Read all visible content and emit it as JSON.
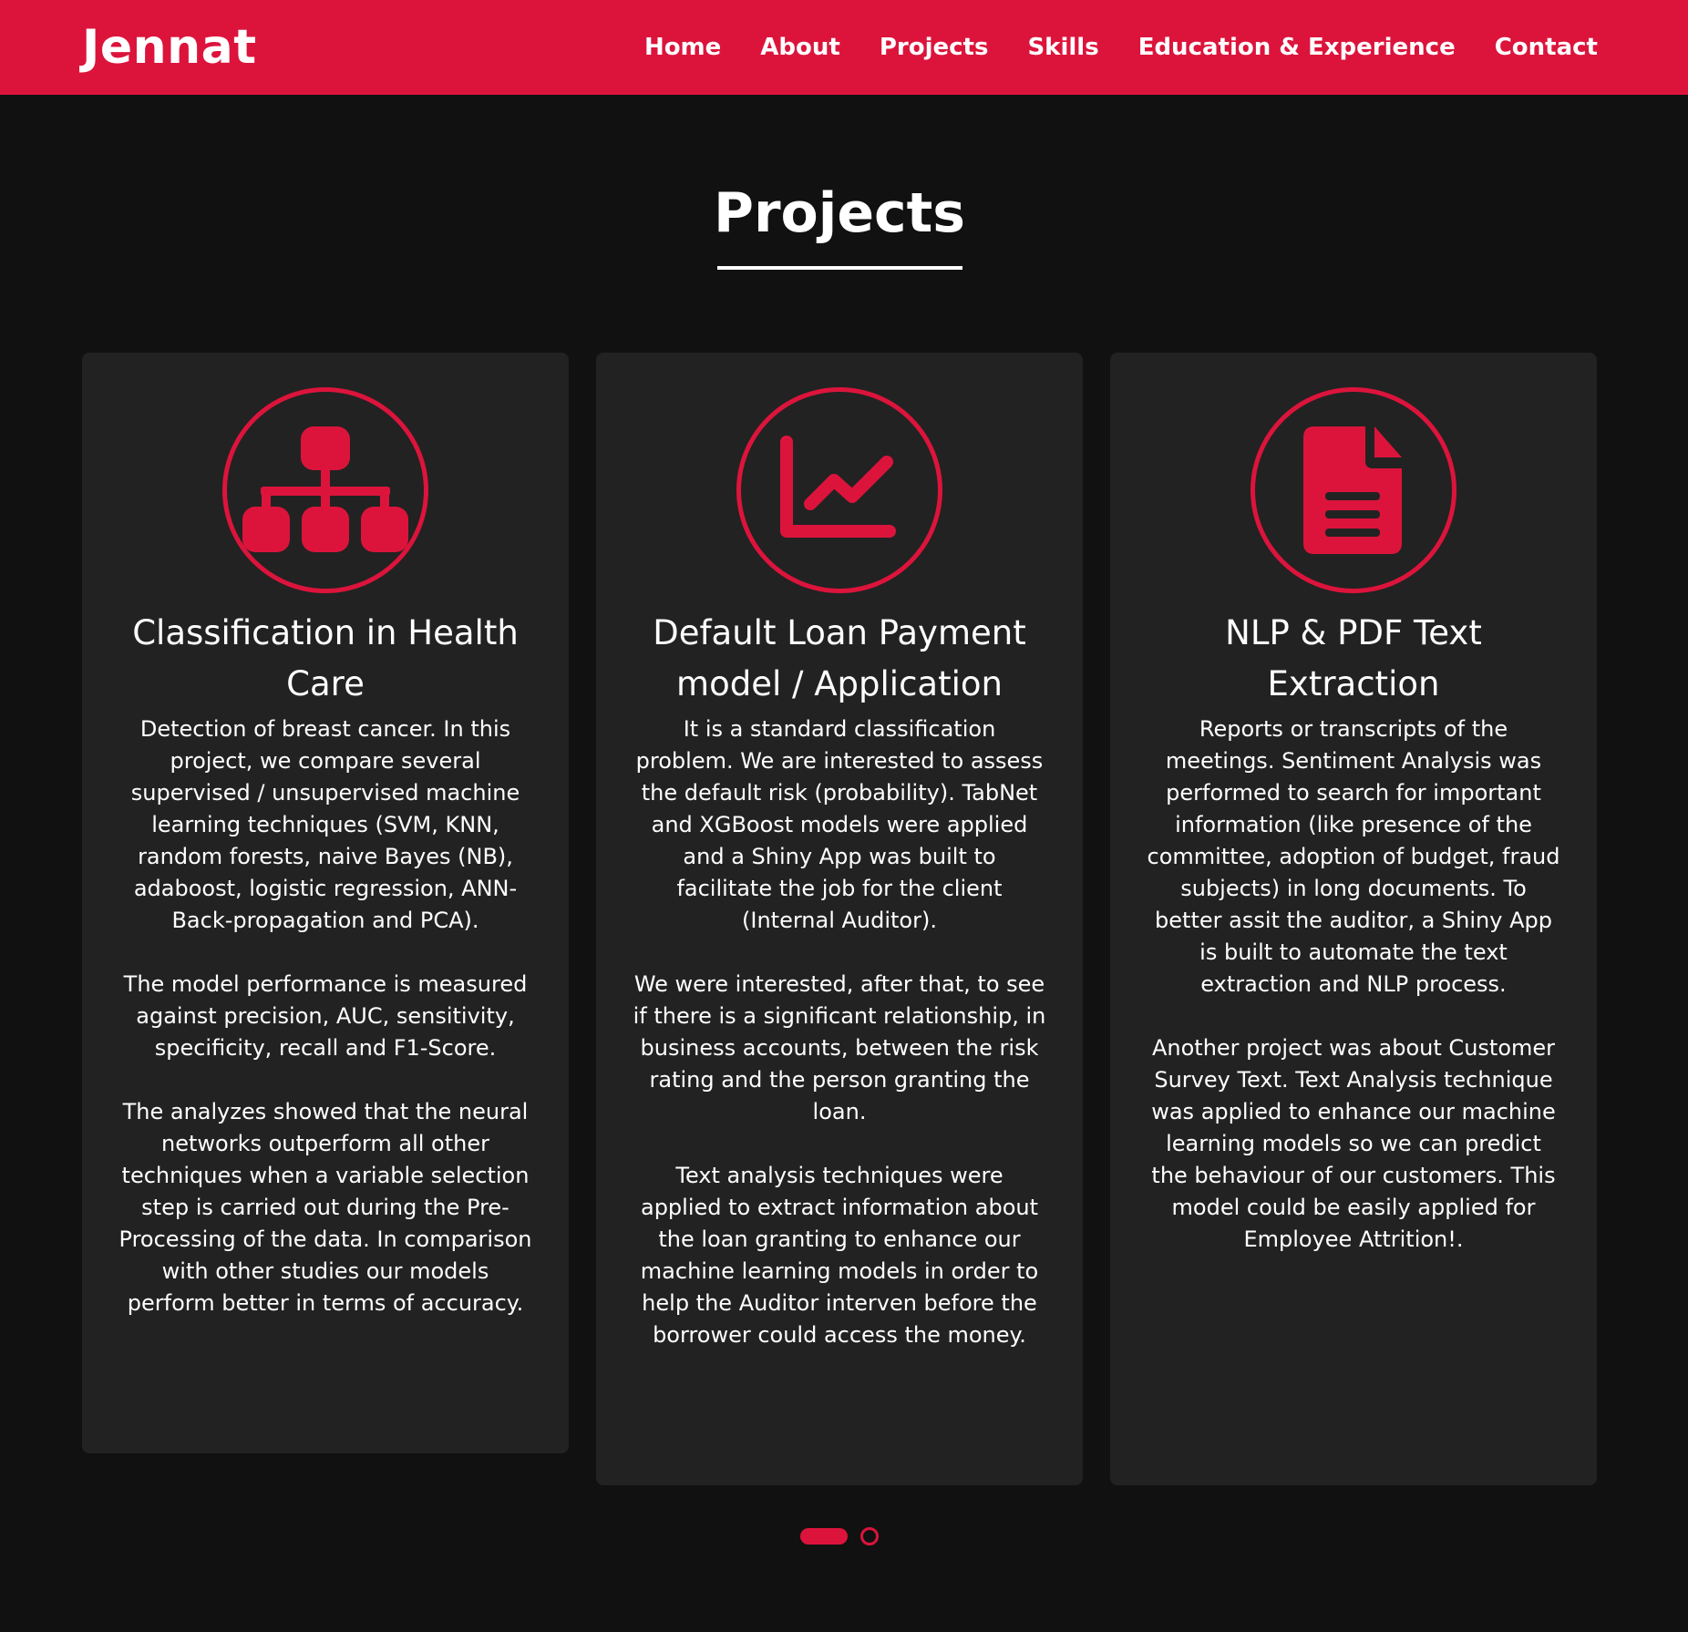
{
  "brand": {
    "name": "Jennat",
    "accent": "#dc143c",
    "background": "#111111",
    "card_background": "#222222"
  },
  "nav": {
    "items": [
      {
        "label": "Home"
      },
      {
        "label": "About"
      },
      {
        "label": "Projects"
      },
      {
        "label": "Skills"
      },
      {
        "label": "Education & Experience"
      },
      {
        "label": "Contact"
      }
    ]
  },
  "section": {
    "title": "Projects"
  },
  "projects": [
    {
      "icon": "sitemap-icon",
      "title": "Classification in Health Care",
      "paragraphs": [
        "Detection of breast cancer. In this project, we compare several supervised / unsupervised machine learning techniques (SVM, KNN, random forests, naive Bayes (NB), adaboost, logistic regression, ANN-Back-propagation and PCA).",
        "The model performance is measured against precision, AUC, sensitivity, specificity, recall and F1-Score.",
        "The analyzes showed that the neural networks outperform all other techniques when a variable selection step is carried out during the Pre-Processing of the data. In comparison with other studies our models perform better in terms of accuracy."
      ]
    },
    {
      "icon": "line-chart-icon",
      "title": "Default Loan Payment model / Application",
      "paragraphs": [
        "It is a standard classification problem. We are interested to assess the default risk (probability). TabNet and XGBoost models were applied and a Shiny App was built to facilitate the job for the client (Internal Auditor).",
        "We were interested, after that, to see if there is a significant relationship, in business accounts, between the risk rating and the person granting the loan.",
        "Text analysis techniques were applied to extract information about the loan granting to enhance our machine learning models in order to help the Auditor interven before the borrower could access the money."
      ]
    },
    {
      "icon": "file-document-icon",
      "title": "NLP & PDF Text Extraction",
      "paragraphs": [
        "Reports or transcripts of the meetings. Sentiment Analysis was performed to search for important information (like presence of the committee, adoption of budget, fraud subjects) in long documents. To better assit the auditor, a Shiny App is built to automate the text extraction and NLP process.",
        "Another project was about Customer Survey Text. Text Analysis technique was applied to enhance our machine learning models so we can predict the behaviour of our customers. This model could be easily applied for Employee Attrition!."
      ]
    }
  ],
  "carousel": {
    "active_page": 1,
    "page_count": 2
  }
}
